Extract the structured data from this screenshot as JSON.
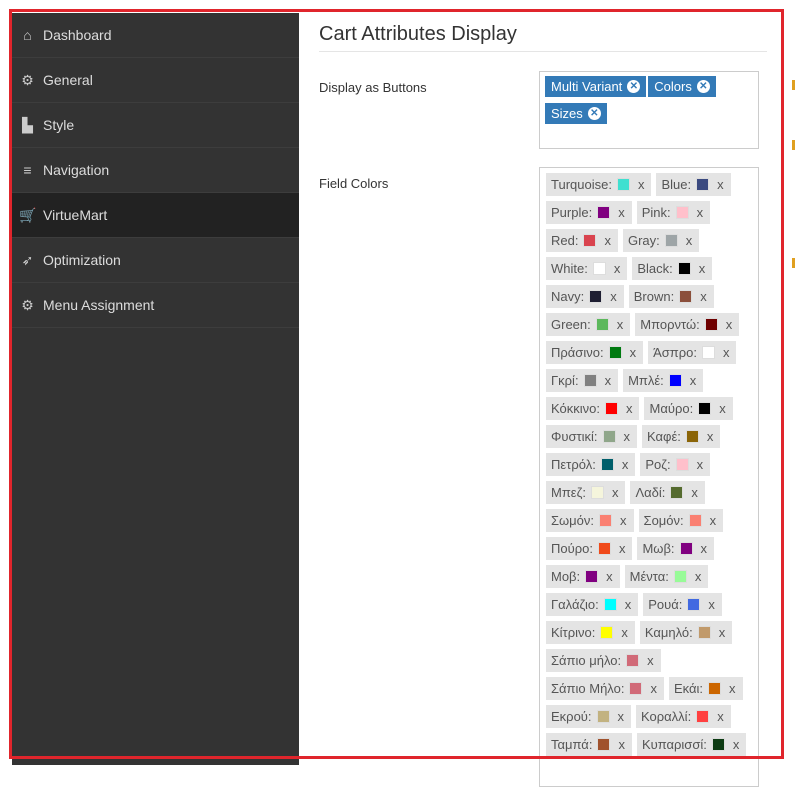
{
  "sidebar": {
    "items": [
      {
        "label": "Dashboard",
        "icon": "home-icon",
        "glyph": "⌂"
      },
      {
        "label": "General",
        "icon": "gear-icon",
        "glyph": "⚙"
      },
      {
        "label": "Style",
        "icon": "chart-icon",
        "glyph": "▙"
      },
      {
        "label": "Navigation",
        "icon": "menu-icon",
        "glyph": "≡"
      },
      {
        "label": "VirtueMart",
        "icon": "cart-icon",
        "glyph": "🛒",
        "active": true
      },
      {
        "label": "Optimization",
        "icon": "rocket-icon",
        "glyph": "➶"
      },
      {
        "label": "Menu Assignment",
        "icon": "gears-icon",
        "glyph": "⚙"
      }
    ]
  },
  "main": {
    "title": "Cart Attributes Display",
    "display_buttons": {
      "label": "Display as Buttons",
      "tags": [
        "Multi Variant",
        "Colors",
        "Sizes"
      ]
    },
    "field_colors": {
      "label": "Field Colors",
      "remove": "x",
      "rows": [
        [
          {
            "name": "Turquoise:",
            "color": "#40e0d0"
          },
          {
            "name": "Blue:",
            "color": "#3b4a80"
          }
        ],
        [
          {
            "name": "Purple:",
            "color": "#800080"
          },
          {
            "name": "Pink:",
            "color": "#ffc0cb"
          }
        ],
        [
          {
            "name": "Red:",
            "color": "#d9434e"
          },
          {
            "name": "Gray:",
            "color": "#9ea5a7"
          }
        ],
        [
          {
            "name": "White:",
            "color": "#ffffff"
          },
          {
            "name": "Black:",
            "color": "#000000"
          }
        ],
        [
          {
            "name": "Navy:",
            "color": "#1e1e32"
          },
          {
            "name": "Brown:",
            "color": "#8b4f3b"
          }
        ],
        [
          {
            "name": "Green:",
            "color": "#5cb85c"
          },
          {
            "name": "Μπορντώ:",
            "color": "#6e0000"
          }
        ],
        [
          {
            "name": "Πράσινο:",
            "color": "#007a10"
          },
          {
            "name": "Άσπρο:",
            "color": "#ffffff"
          }
        ],
        [
          {
            "name": "Γκρί:",
            "color": "#808080"
          },
          {
            "name": "Μπλέ:",
            "color": "#0000ff"
          }
        ],
        [
          {
            "name": "Κόκκινο:",
            "color": "#ff0000"
          },
          {
            "name": "Μαύρο:",
            "color": "#000000"
          }
        ],
        [
          {
            "name": "Φυστικί:",
            "color": "#8fa68a"
          },
          {
            "name": "Καφέ:",
            "color": "#8b6508"
          }
        ],
        [
          {
            "name": "Πετρόλ:",
            "color": "#005f6b"
          },
          {
            "name": "Ροζ:",
            "color": "#ffc0cb"
          }
        ],
        [
          {
            "name": "Μπεζ:",
            "color": "#f5f5dc"
          },
          {
            "name": "Λαδί:",
            "color": "#556b2f"
          }
        ],
        [
          {
            "name": "Σωμόν:",
            "color": "#fa8072"
          },
          {
            "name": "Σομόν:",
            "color": "#fa8072"
          }
        ],
        [
          {
            "name": "Πούρο:",
            "color": "#f04a1a"
          },
          {
            "name": "Μωβ:",
            "color": "#800080"
          }
        ],
        [
          {
            "name": "Μοβ:",
            "color": "#800080"
          },
          {
            "name": "Μέντα:",
            "color": "#98fb98"
          }
        ],
        [
          {
            "name": "Γαλάζιο:",
            "color": "#00ffff"
          },
          {
            "name": "Ρουά:",
            "color": "#4169e1"
          }
        ],
        [
          {
            "name": "Κίτρινο:",
            "color": "#ffff00"
          },
          {
            "name": "Καμηλό:",
            "color": "#c19a6b"
          }
        ],
        [
          {
            "name": "Σάπιο μήλο:",
            "color": "#d16a78"
          }
        ],
        [
          {
            "name": "Σάπιο Μήλο:",
            "color": "#d16a78"
          },
          {
            "name": "Εκάι:",
            "color": "#cc6600"
          }
        ],
        [
          {
            "name": "Εκρού:",
            "color": "#c2b280"
          },
          {
            "name": "Κοραλλί:",
            "color": "#ff4040"
          }
        ],
        [
          {
            "name": "Ταμπά:",
            "color": "#a0522d"
          },
          {
            "name": "Κυπαρισσί:",
            "color": "#0d3b13"
          }
        ]
      ]
    }
  },
  "accent": "#337ab7",
  "frame_color": "#e0252c"
}
